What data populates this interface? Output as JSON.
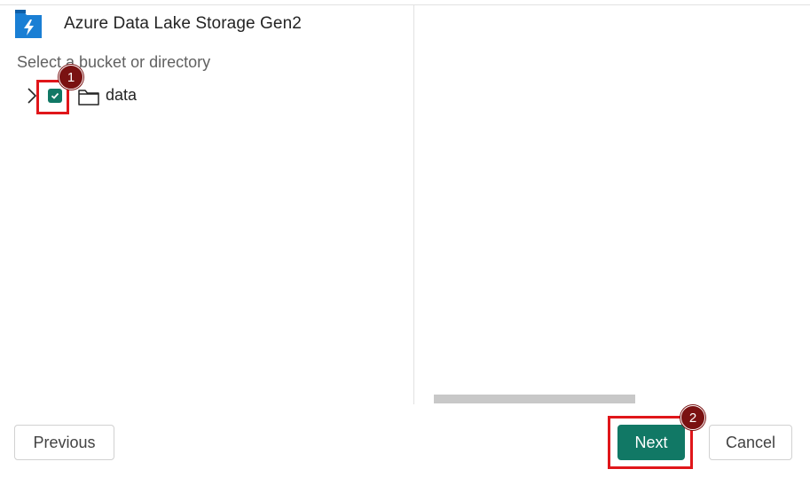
{
  "header": {
    "source_title": "Azure Data Lake Storage Gen2",
    "icon": "azure-data-lake-icon"
  },
  "tree": {
    "section_label": "Select a bucket or directory",
    "items": [
      {
        "label": "data",
        "checked": true,
        "expanded": false,
        "icon": "folder-icon"
      }
    ]
  },
  "annotations": {
    "step1": "1",
    "step2": "2",
    "highlight_color": "#e0161a",
    "badge_color": "#7a1212"
  },
  "footer": {
    "previous_label": "Previous",
    "next_label": "Next",
    "cancel_label": "Cancel"
  },
  "colors": {
    "accent": "#117865"
  }
}
